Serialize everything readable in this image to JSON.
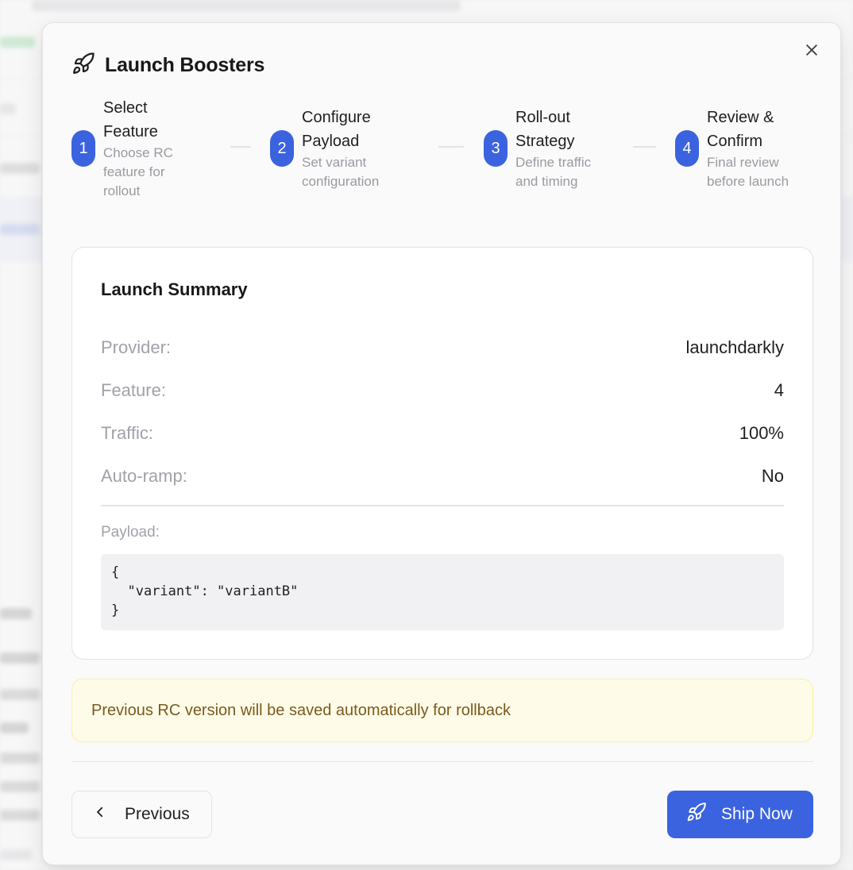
{
  "modal": {
    "title": "Launch Boosters",
    "title_icon": "rocket-icon",
    "close_icon": "close-icon"
  },
  "steps": [
    {
      "number": "1",
      "title_line1": "Select",
      "title_line2": "Feature",
      "desc_line1": "Choose RC",
      "desc_line2": "feature for",
      "desc_line3": "rollout"
    },
    {
      "number": "2",
      "title_line1": "Configure",
      "title_line2": "Payload",
      "desc_line1": "Set variant",
      "desc_line2": "configuration"
    },
    {
      "number": "3",
      "title_line1": "Roll-out",
      "title_line2": "Strategy",
      "desc_line1": "Define traffic",
      "desc_line2": "and timing"
    },
    {
      "number": "4",
      "title_line1": "Review &",
      "title_line2": "Confirm",
      "desc_line1": "Final review",
      "desc_line2": "before launch"
    }
  ],
  "summary": {
    "title": "Launch Summary",
    "rows": [
      {
        "label": "Provider:",
        "value": "launchdarkly"
      },
      {
        "label": "Feature:",
        "value": "4"
      },
      {
        "label": "Traffic:",
        "value": "100%"
      },
      {
        "label": "Auto-ramp:",
        "value": "No"
      }
    ],
    "payload_label": "Payload:",
    "payload_code": "{\n  \"variant\": \"variantB\"\n}"
  },
  "notice": {
    "text": "Previous RC version will be saved automatically for rollback"
  },
  "footer": {
    "previous_label": "Previous",
    "ship_label": "Ship Now"
  },
  "colors": {
    "accent": "#3b63e0",
    "notice_bg": "#fefce8",
    "notice_text": "#7a5a1e"
  }
}
